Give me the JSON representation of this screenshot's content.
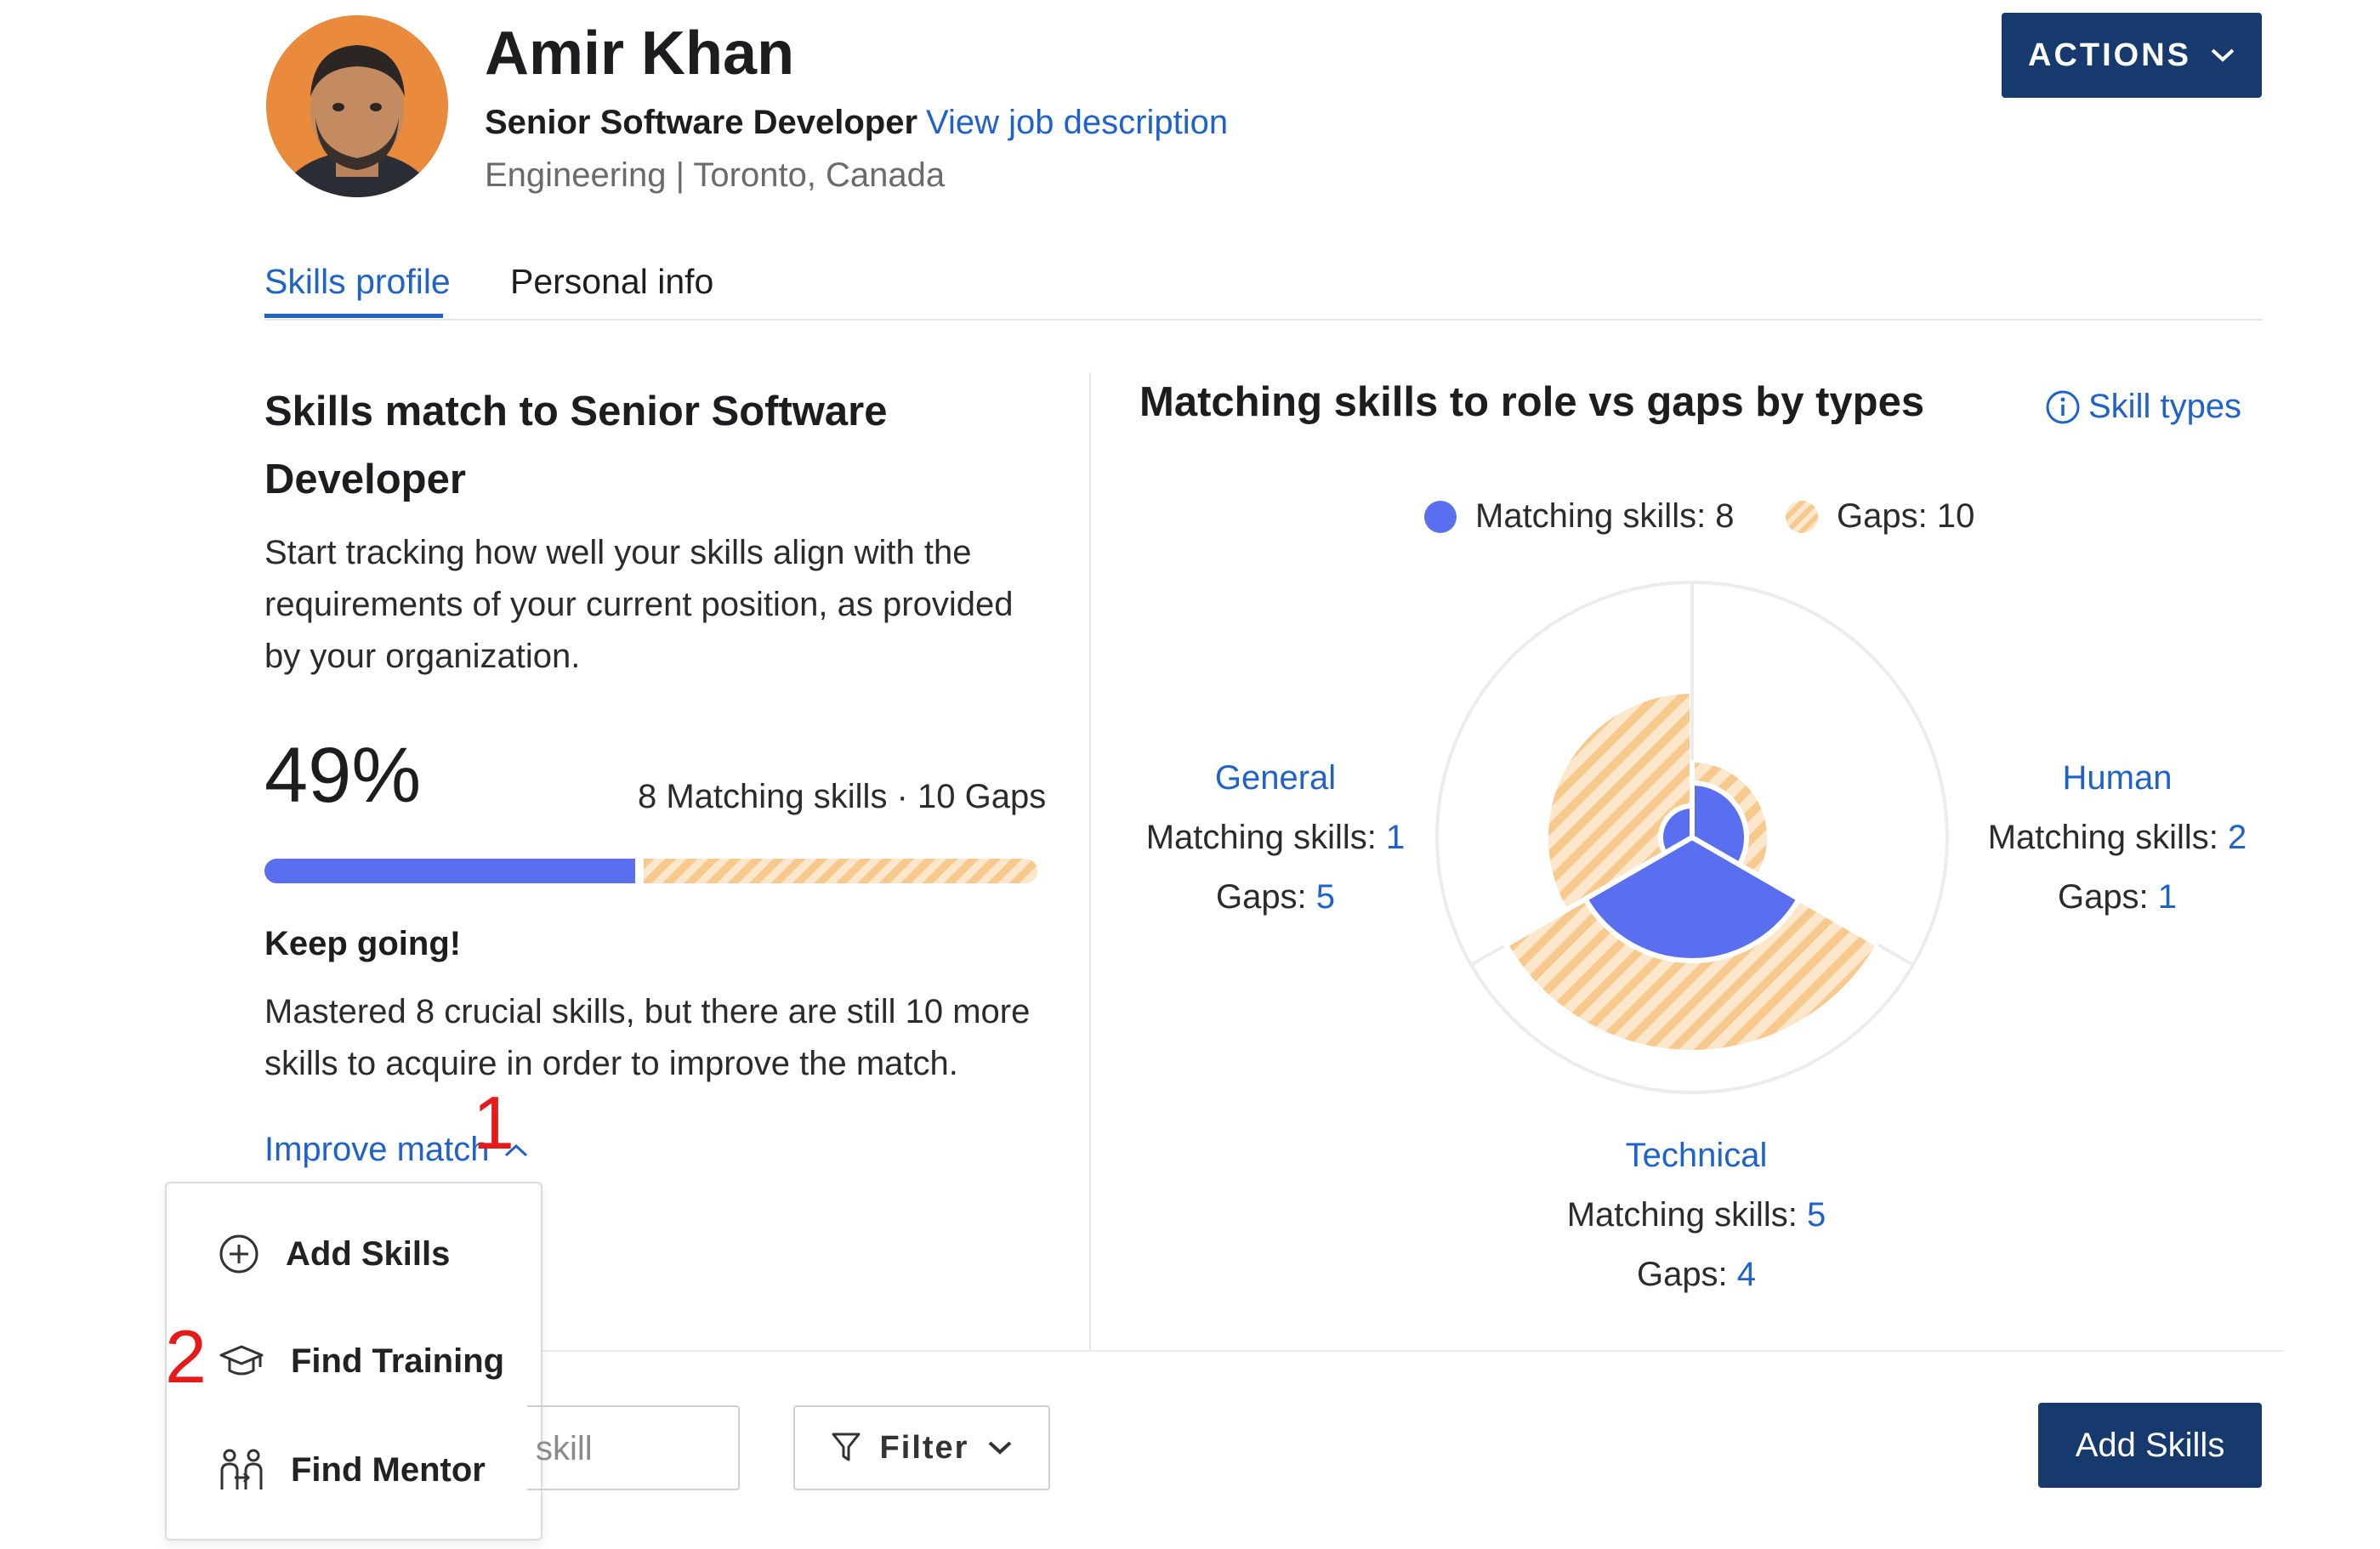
{
  "header": {
    "name": "Amir Khan",
    "job_title": "Senior Software Developer",
    "job_link": "View job description",
    "meta": "Engineering | Toronto, Canada",
    "actions_label": "ACTIONS"
  },
  "tabs": [
    {
      "label": "Skills profile",
      "active": true
    },
    {
      "label": "Personal info",
      "active": false
    }
  ],
  "left": {
    "title": "Skills match to Senior Software Developer",
    "description": "Start tracking how well your skills align with the requirements of your current position, as provided by your organization.",
    "percent": "49%",
    "counts": "8 Matching skills · 10 Gaps",
    "keep_going": "Keep going!",
    "mastered": "Mastered 8 crucial skills, but there are still 10 more skills to acquire in order to improve the match.",
    "improve_label": "Improve match",
    "marker1": "1",
    "marker2": "2"
  },
  "menu": {
    "items": [
      {
        "label": "Add Skills",
        "icon": "plus-circle-icon"
      },
      {
        "label": "Find Training",
        "icon": "graduation-cap-icon"
      },
      {
        "label": "Find Mentor",
        "icon": "mentor-icon"
      }
    ]
  },
  "controls": {
    "search_value": "skill",
    "filter_label": "Filter",
    "add_skills_label": "Add Skills"
  },
  "chart": {
    "title": "Matching skills to role vs gaps by types",
    "skill_types_link": "Skill types",
    "legend_matching": "Matching skills: 8",
    "legend_gaps": "Gaps: 10",
    "matching_label": "Matching skills:",
    "gaps_label": "Gaps:",
    "colors": {
      "matching": "#5a6ff0",
      "gaps": "#f8c98d"
    }
  },
  "chart_data": {
    "type": "radial-bar",
    "categories": [
      "General",
      "Human",
      "Technical"
    ],
    "series": [
      {
        "name": "Matching skills",
        "values": [
          1,
          2,
          5
        ]
      },
      {
        "name": "Gaps",
        "values": [
          5,
          1,
          4
        ]
      }
    ],
    "totals": {
      "matching": 8,
      "gaps": 10,
      "match_percent": 49
    }
  }
}
